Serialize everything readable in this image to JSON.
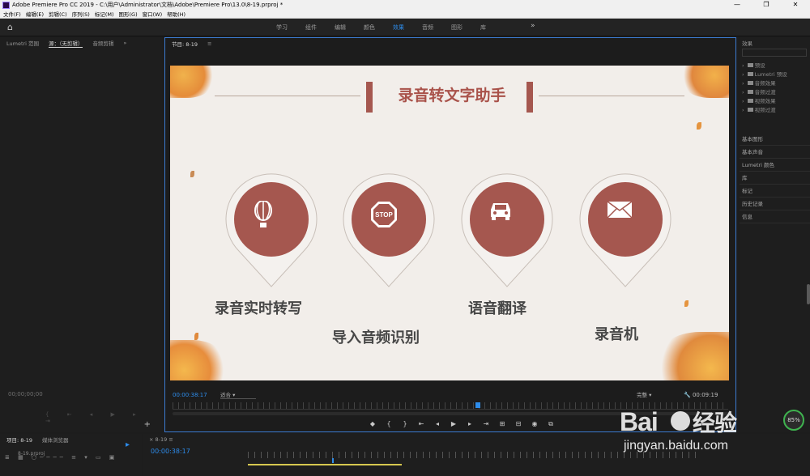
{
  "window": {
    "title": "Adobe Premiere Pro CC 2019 - C:\\用户\\Administrator\\文档\\Adobe\\Premiere Pro\\13.0\\8-19.prproj *",
    "controls": [
      "—",
      "❐",
      "✕"
    ]
  },
  "menu": [
    "文件(F)",
    "编辑(E)",
    "剪辑(C)",
    "序列(S)",
    "标记(M)",
    "图形(G)",
    "窗口(W)",
    "帮助(H)"
  ],
  "workspaces": {
    "tabs": [
      "学习",
      "组件",
      "编辑",
      "颜色",
      "效果",
      "音频",
      "图形",
      "库"
    ],
    "active": "效果"
  },
  "source_panel": {
    "tabs": [
      "Lumetri 范围",
      "源：（无剪辑）",
      "音频剪辑"
    ],
    "timecode": "00;00;00;00"
  },
  "program_panel": {
    "title": "节目: 8-19",
    "timecode": "00:00:38:17",
    "fit": "适合",
    "quality": "完整",
    "duration": "00:09:19"
  },
  "slide": {
    "title": "录音转文字助手",
    "features": [
      {
        "label": "录音实时转写",
        "icon": "balloon-icon"
      },
      {
        "label": "导入音频识别",
        "icon": "stop-sign-icon"
      },
      {
        "label": "语音翻译",
        "icon": "car-icon"
      },
      {
        "label": "录音机",
        "icon": "envelope-icon"
      }
    ],
    "colors": {
      "accent": "#a5574f",
      "background": "#f2eeea",
      "text": "#474747"
    }
  },
  "effects_panel": {
    "title": "效果",
    "tree": [
      "预设",
      "Lumetri 预设",
      "音频效果",
      "音频过渡",
      "视频效果",
      "视频过渡"
    ],
    "panels": [
      "基本图形",
      "基本声音",
      "Lumetri 颜色",
      "库",
      "标记",
      "历史记录",
      "信息"
    ]
  },
  "project_panel": {
    "tabs": [
      "项目: 8-19",
      "媒体浏览器"
    ],
    "item": "8-19.prproj"
  },
  "timeline": {
    "sequence": "8-19",
    "timecode": "00:00:38:17"
  },
  "status": {
    "progress": "85%"
  },
  "watermark": {
    "logo": "Baidu经验",
    "url": "jingyan.baidu.com"
  }
}
